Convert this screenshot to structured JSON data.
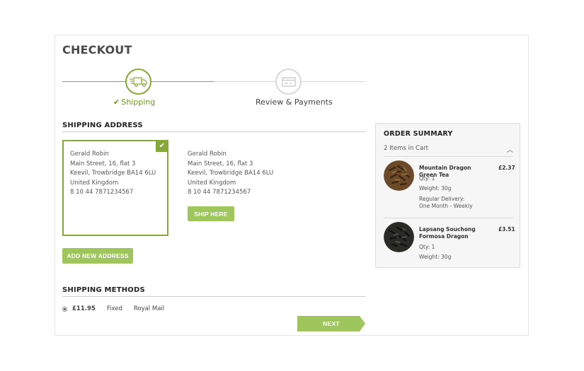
{
  "page": {
    "title": "CHECKOUT"
  },
  "steps": [
    {
      "label": "Shipping",
      "state": "active",
      "icon": "truck-icon"
    },
    {
      "label": "Review & Payments",
      "state": "inactive",
      "icon": "card-icon"
    }
  ],
  "shipping_address": {
    "title": "SHIPPING ADDRESS",
    "addresses": [
      {
        "selected": true,
        "name": "Gerald Robin",
        "street": "Main Street, 16, flat 3",
        "city": "Keevil, Trowbridge BA14 6LU",
        "country": "United Kingdom",
        "phone": "8 10 44 7871234567"
      },
      {
        "selected": false,
        "name": "Gerald Robin",
        "street": "Main Street, 16, flat 3",
        "city": "Keevil, Trowbridge BA14 6LU",
        "country": "United Kingdom",
        "phone": "8 10 44 7871234567",
        "button_label": "SHIP HERE"
      }
    ],
    "add_button_label": "ADD NEW ADDRESS"
  },
  "shipping_methods": {
    "title": "SHIPPING METHODS",
    "options": [
      {
        "selected": true,
        "price": "£11.95",
        "type": "Fixed",
        "carrier": "Royal Mail"
      }
    ]
  },
  "next_button_label": "NEXT",
  "order_summary": {
    "title": "ORDER SUMMARY",
    "count_label": "2 Items in Cart",
    "items": [
      {
        "name": "Mountain Dragon Green Tea",
        "price": "£2.37",
        "qty": "Qty:  1",
        "weight": "Weight:  30g",
        "delivery_label": "Regular Delivery:",
        "delivery_value": "One Month - Weekly"
      },
      {
        "name": "Lapsang Souchong Formosa Dragon",
        "price": "£3.51",
        "qty": "Qty:  1",
        "weight": "Weight:  30g"
      }
    ]
  },
  "colors": {
    "accent": "#86a83a",
    "button": "#9ec65c",
    "step_active_text": "#6f9a1f",
    "summary_bg": "#f6f6f6"
  }
}
